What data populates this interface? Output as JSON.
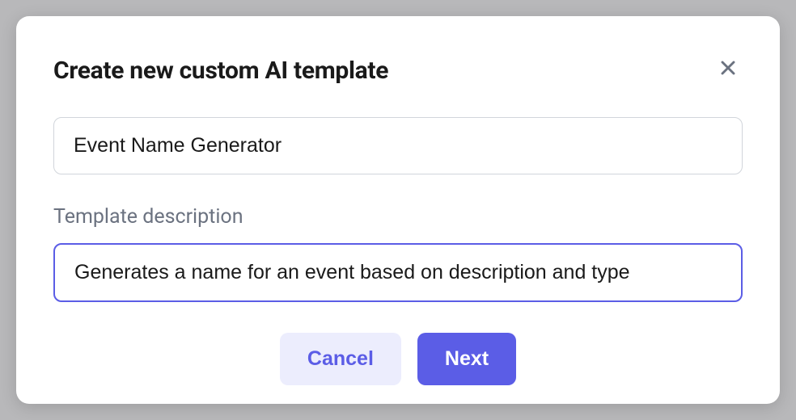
{
  "modal": {
    "title": "Create new custom AI template",
    "name_value": "Event Name Generator",
    "description_label": "Template description",
    "description_value": "Generates a name for an event based on description and type",
    "cancel_label": "Cancel",
    "next_label": "Next"
  },
  "colors": {
    "primary": "#5b5de6",
    "primary_light": "#ecedfd",
    "border": "#d1d5db",
    "text": "#1a1a1a",
    "muted": "#6b7280"
  }
}
